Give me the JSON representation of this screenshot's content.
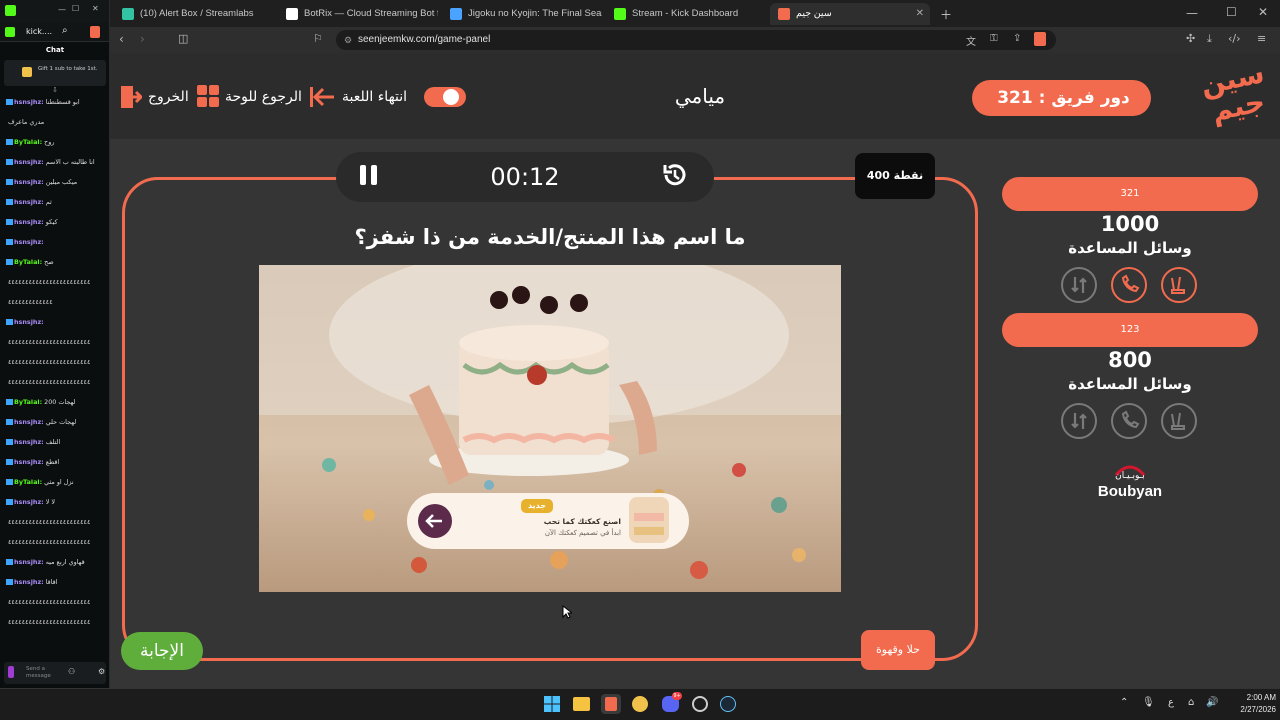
{
  "kick_window": {
    "title": "kick....",
    "chat_heading": "Chat",
    "gift_text": "Gift 1 sub to take 1st.",
    "input_placeholder": "Send a message",
    "messages": [
      {
        "user": "hsnsjhz:",
        "text": "ابو قسطنطنا",
        "ucls": "u2"
      },
      {
        "user": "",
        "text": "مدري ماعرف",
        "ucls": "u1"
      },
      {
        "user": "ByTalal:",
        "text": "روح",
        "ucls": "u1"
      },
      {
        "user": "hsnsjhz:",
        "text": "انا طالبته ب الاسم",
        "ucls": "u2"
      },
      {
        "user": "hsnsjhz:",
        "text": "ميكب ميلين",
        "ucls": "u2"
      },
      {
        "user": "hsnsjhz:",
        "text": "ثم",
        "ucls": "u2"
      },
      {
        "user": "hsnsjhz:",
        "text": "كيكو",
        "ucls": "u2"
      },
      {
        "user": "hsnsjhz:",
        "text": "",
        "ucls": "u2"
      },
      {
        "user": "ByTalal:",
        "text": "صح",
        "ucls": "u1"
      },
      {
        "user": "",
        "text": "٤٤٤٤٤٤٤٤٤٤٤٤٤٤٤٤٤٤٤٤٤٤٤٤",
        "ucls": "u1"
      },
      {
        "user": "",
        "text": "٤٤٤٤٤٤٤٤٤٤٤٤٤",
        "ucls": "u1"
      },
      {
        "user": "hsnsjhz:",
        "text": "",
        "ucls": "u2"
      },
      {
        "user": "",
        "text": "٤٤٤٤٤٤٤٤٤٤٤٤٤٤٤٤٤٤٤٤٤٤٤٤",
        "ucls": "u1"
      },
      {
        "user": "",
        "text": "٤٤٤٤٤٤٤٤٤٤٤٤٤٤٤٤٤٤٤٤٤٤٤٤",
        "ucls": "u1"
      },
      {
        "user": "",
        "text": "٤٤٤٤٤٤٤٤٤٤٤٤٤٤٤٤٤٤٤٤٤٤٤٤",
        "ucls": "u1"
      },
      {
        "user": "ByTalal:",
        "text": "لهجات 200",
        "ucls": "u1"
      },
      {
        "user": "hsnsjhz:",
        "text": "لهجات حلي",
        "ucls": "u2"
      },
      {
        "user": "hsnsjhz:",
        "text": "التلف",
        "ucls": "u2"
      },
      {
        "user": "hsnsjhz:",
        "text": "اقطع",
        "ucls": "u2"
      },
      {
        "user": "ByTalal:",
        "text": "نزل او مثي",
        "ucls": "u1"
      },
      {
        "user": "hsnsjhz:",
        "text": "لا لا",
        "ucls": "u2"
      },
      {
        "user": "",
        "text": "٤٤٤٤٤٤٤٤٤٤٤٤٤٤٤٤٤٤٤٤٤٤٤٤",
        "ucls": "u1"
      },
      {
        "user": "",
        "text": "٤٤٤٤٤٤٤٤٤٤٤٤٤٤٤٤٤٤٤٤٤٤٤٤",
        "ucls": "u1"
      },
      {
        "user": "hsnsjhz:",
        "text": "قهاوي اربع ميه",
        "ucls": "u2"
      },
      {
        "user": "hsnsjhz:",
        "text": "اقاقا",
        "ucls": "u2"
      },
      {
        "user": "",
        "text": "٤٤٤٤٤٤٤٤٤٤٤٤٤٤٤٤٤٤٤٤٤٤٤٤",
        "ucls": "u1"
      },
      {
        "user": "",
        "text": "٤٤٤٤٤٤٤٤٤٤٤٤٤٤٤٤٤٤٤٤٤٤٤٤",
        "ucls": "u1"
      }
    ]
  },
  "browser": {
    "tabs": [
      {
        "label": "(10) Alert Box / Streamlabs",
        "color": "#31c3a2"
      },
      {
        "label": "BotRix — Cloud Streaming Bot for Tw",
        "color": "#ffffff"
      },
      {
        "label": "Jigoku no Kyojin: The Final Season انمي",
        "color": "#4aa3ff"
      },
      {
        "label": "Stream - Kick Dashboard",
        "color": "#53fc18"
      },
      {
        "label": "سين جيم",
        "color": "#f26b4e"
      }
    ],
    "url": "seenjeemkw.com/game-panel"
  },
  "game": {
    "team_turn_label": "دور فريق :",
    "team_turn_value": "321",
    "logo_text": "سين جيم",
    "city": "ميامي",
    "end_game": "انتهاء اللعبة",
    "back_to_board": "الرجوع للوحة",
    "exit": "الخروج",
    "timer": "00:12",
    "points": "400 نقطة",
    "question": "ما اسم هذا المنتج/الخدمة من ذا شفز؟",
    "answer_button": "الإجابة",
    "category": "حلا وقهوة",
    "image": {
      "badge": "جديد",
      "line1": "اصنع كعكتك كما تحب",
      "line2": "ابدأ في تصميم كعكتك الآن"
    }
  },
  "teams": [
    {
      "name": "321",
      "score": "1000",
      "aids_label": "وسائل المساعدة",
      "aids_active": true
    },
    {
      "name": "123",
      "score": "800",
      "aids_label": "وسائل المساعدة",
      "aids_active": false
    }
  ],
  "sponsor": {
    "arabic": "بـوبـيـان",
    "latin": "Boubyan"
  },
  "taskbar": {
    "time": "2:00 AM",
    "date": "2/27/2026",
    "lang": "ع",
    "discord_badge": "9+"
  }
}
